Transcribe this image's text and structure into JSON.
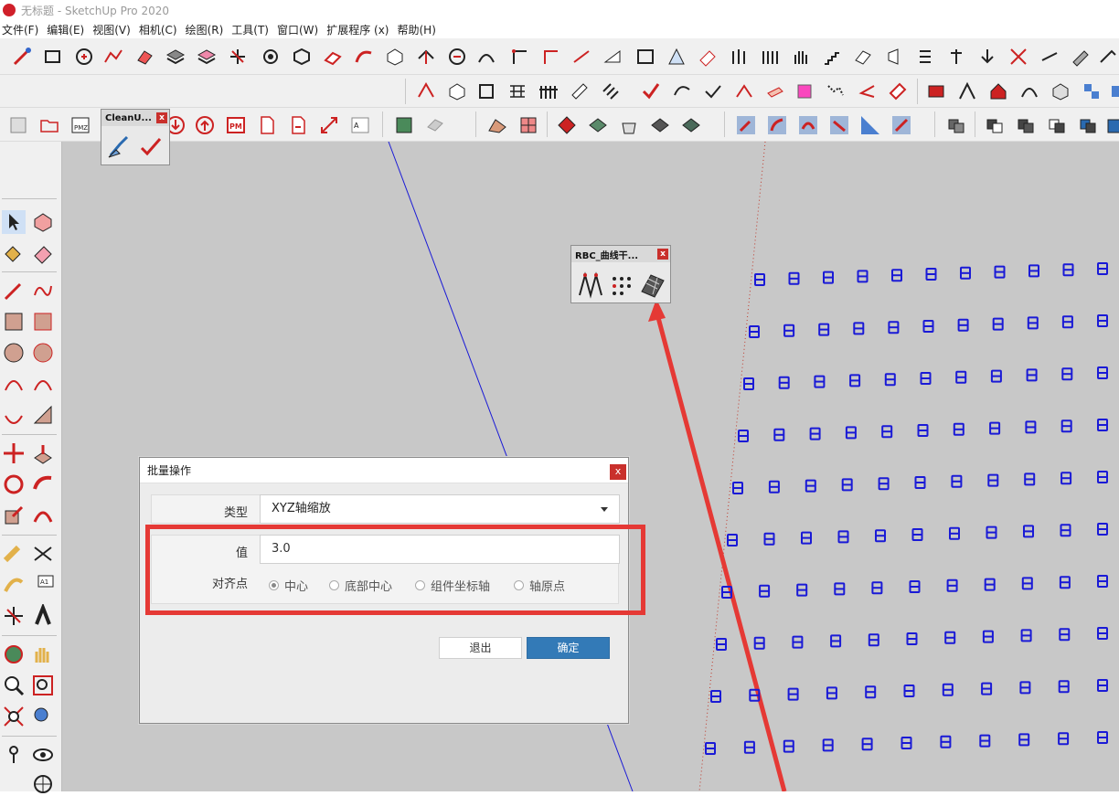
{
  "window": {
    "title": "无标题 - SketchUp Pro 2020"
  },
  "menu": [
    "文件(F)",
    "编辑(E)",
    "视图(V)",
    "相机(C)",
    "绘图(R)",
    "工具(T)",
    "窗口(W)",
    "扩展程序 (x)",
    "帮助(H)"
  ],
  "panels": {
    "cleanup": {
      "title": "CleanU...",
      "close": "x"
    },
    "rbc": {
      "title": "RBC_曲线干...",
      "close": "x"
    }
  },
  "dialog": {
    "title": "批量操作",
    "close": "x",
    "type_label": "类型",
    "type_value": "XYZ轴缩放",
    "value_label": "值",
    "value_value": "3.0",
    "align_label": "对齐点",
    "align_options": [
      {
        "label": "中心",
        "selected": true
      },
      {
        "label": "底部中心",
        "selected": false
      },
      {
        "label": "组件坐标轴",
        "selected": false
      },
      {
        "label": "轴原点",
        "selected": false
      }
    ],
    "exit_label": "退出",
    "ok_label": "确定"
  },
  "colors": {
    "accent": "#337ab7",
    "highlight": "#e53935",
    "component_blue": "#1a1ad6",
    "viewport": "#c8c8c8"
  }
}
